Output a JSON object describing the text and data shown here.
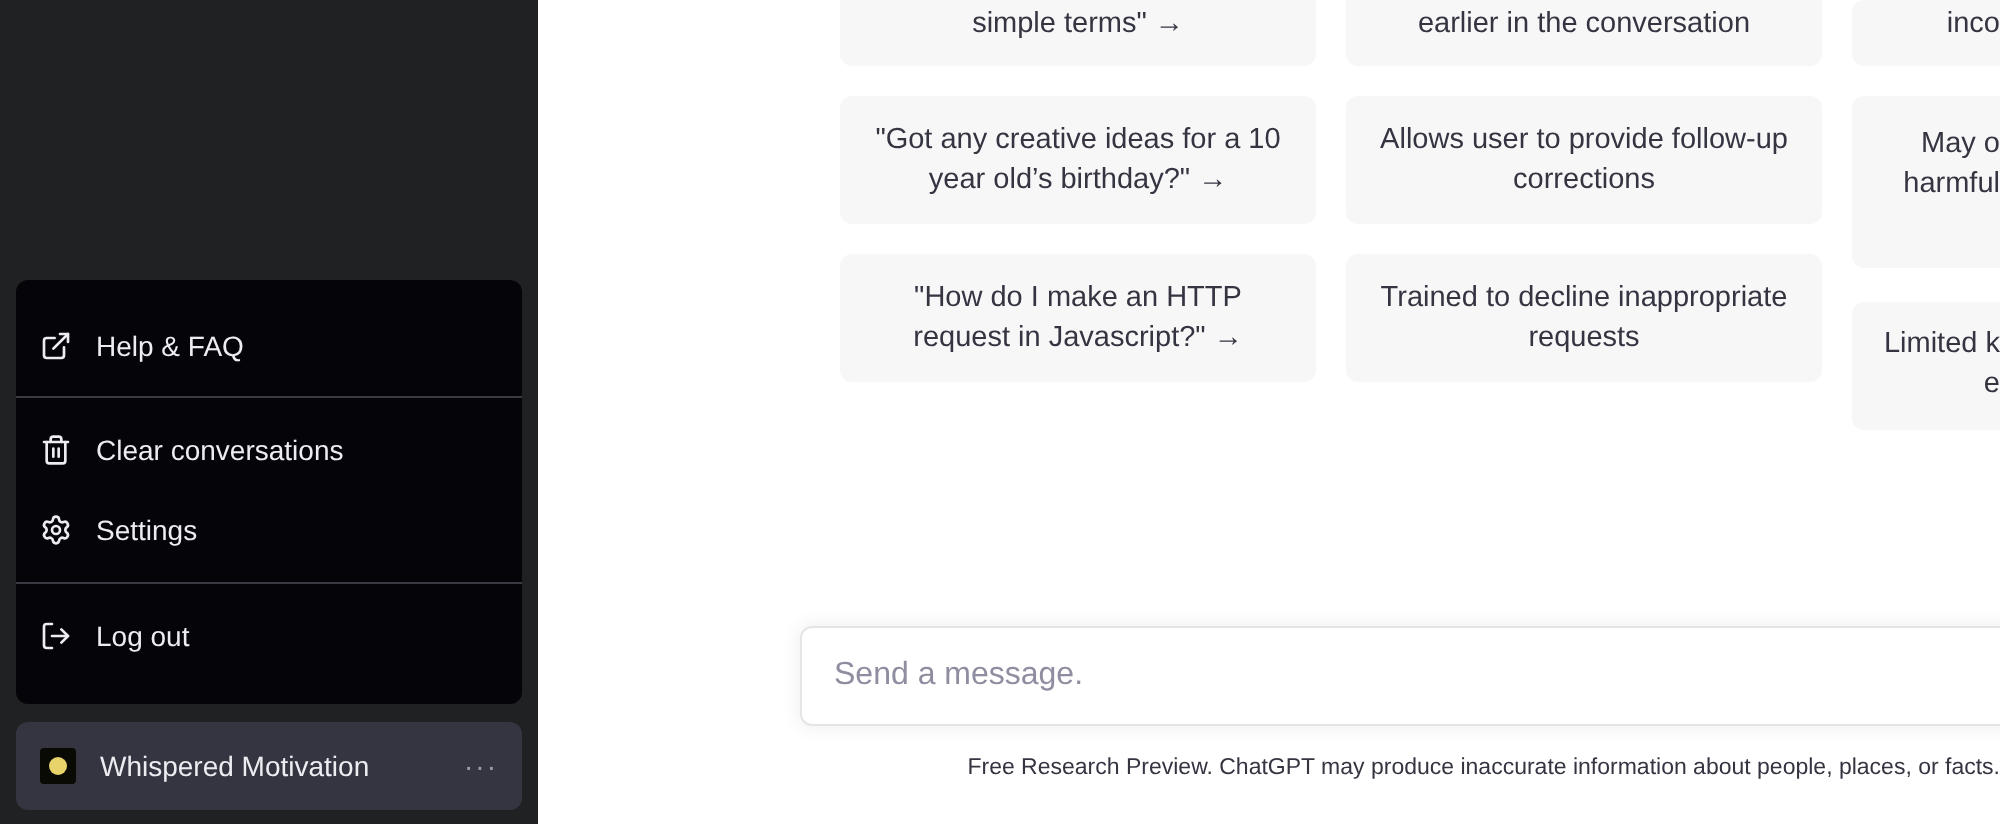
{
  "sidebar": {
    "menu": [
      {
        "items": [
          {
            "label": "Help & FAQ",
            "kind": "external-link"
          }
        ]
      },
      {
        "items": [
          {
            "label": "Clear conversations",
            "kind": "trash"
          },
          {
            "label": "Settings",
            "kind": "settings"
          }
        ]
      },
      {
        "items": [
          {
            "label": "Log out",
            "kind": "logout"
          }
        ]
      }
    ],
    "user": {
      "name": "Whispered Motivation",
      "menu_glyph": "···"
    }
  },
  "columns": [
    {
      "cards": [
        {
          "text": "simple terms\" →"
        },
        {
          "text": "\"Got any creative ideas for a 10 year old’s birthday?\" →"
        },
        {
          "text": "\"How do I make an HTTP request in Javascript?\" →"
        }
      ]
    },
    {
      "cards": [
        {
          "text": "earlier in the conversation"
        },
        {
          "text": "Allows user to provide follow-up corrections"
        },
        {
          "text": "Trained to decline inappropriate requests"
        }
      ]
    },
    {
      "cards": [
        {
          "lines": [
            "inco"
          ]
        },
        {
          "lines": [
            "May o",
            "harmful"
          ]
        },
        {
          "lines": [
            "Limited k",
            "e"
          ]
        }
      ]
    }
  ],
  "composer": {
    "placeholder": "Send a message."
  },
  "footer": "Free Research Preview. ChatGPT may produce inaccurate information about people, places, or facts."
}
